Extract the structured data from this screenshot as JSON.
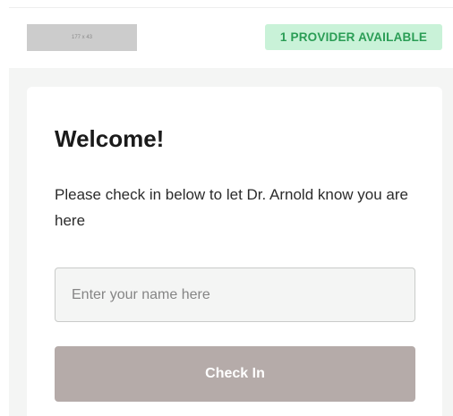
{
  "header": {
    "logo_placeholder_text": "177 x 43",
    "provider_badge": "1 PROVIDER AVAILABLE"
  },
  "card": {
    "title": "Welcome!",
    "message": "Please check in below to let Dr. Arnold know you are here",
    "name_input": {
      "value": "",
      "placeholder": "Enter your name here"
    },
    "checkin_button_label": "Check In"
  },
  "colors": {
    "badge_background": "#c9f2d8",
    "badge_text": "#2a9d55",
    "button_background": "#b5aba9",
    "page_background": "#f4f5f4"
  }
}
